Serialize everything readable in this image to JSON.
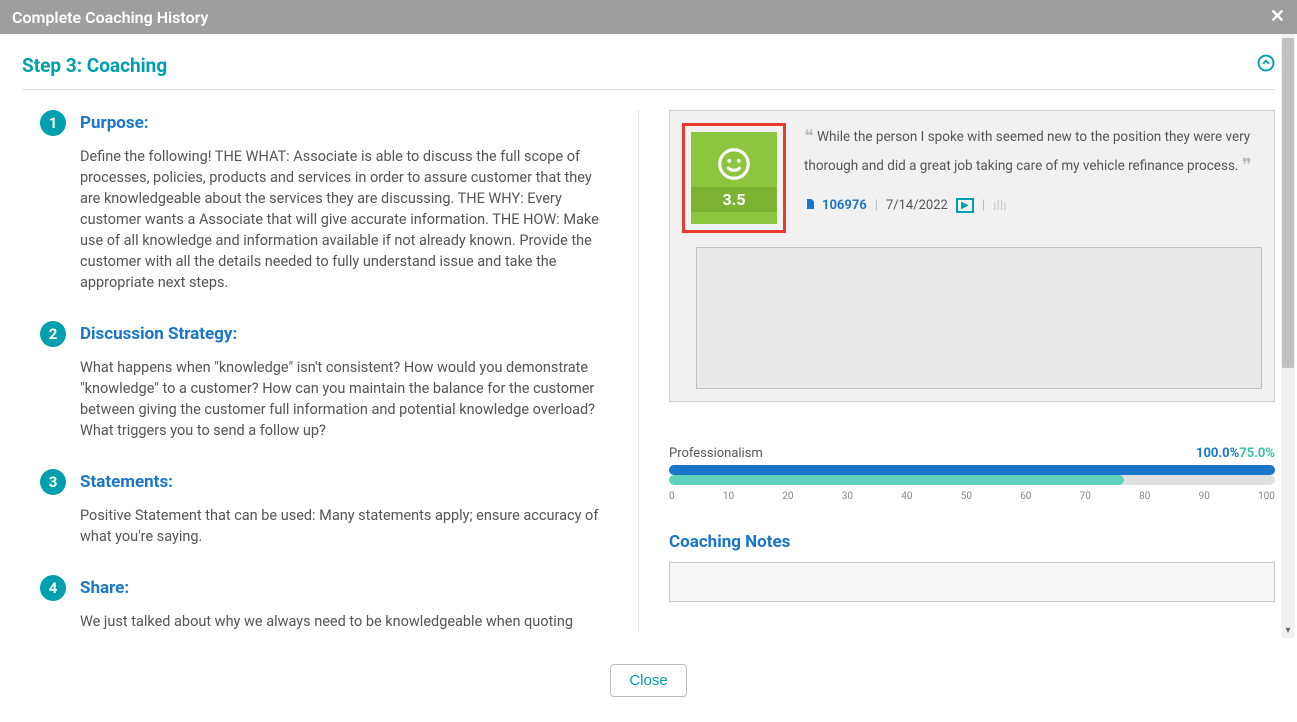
{
  "header": {
    "title": "Complete Coaching History"
  },
  "step": {
    "title": "Step 3: Coaching"
  },
  "sections": [
    {
      "num": "1",
      "title": "Purpose:",
      "body": "Define the following! THE WHAT: Associate is able to discuss the full scope of processes, policies, products and services in order to assure customer that they are knowledgeable about the services they are discussing. THE WHY: Every customer wants a Associate that will give accurate information. THE HOW: Make use of all knowledge and information available if not already known. Provide the customer with all the details needed to fully understand issue and take the appropriate next steps."
    },
    {
      "num": "2",
      "title": "Discussion Strategy:",
      "body": "What happens when \"knowledge\" isn't consistent? How would you demonstrate \"knowledge\" to a customer? How can you maintain the balance for the customer between giving the customer full information and potential knowledge overload? What triggers you to send a follow up?"
    },
    {
      "num": "3",
      "title": "Statements:",
      "body": "Positive Statement that can be used: Many statements apply; ensure accuracy of what you're saying."
    },
    {
      "num": "4",
      "title": "Share:",
      "body": "We just talked about why we always need to be knowledgeable when quoting"
    }
  ],
  "record": {
    "score": "3.5",
    "quote": "While the person I spoke with seemed new to the position they were very thorough and did a great job taking care of my vehicle refinance process.",
    "id": "106976",
    "date": "7/14/2022"
  },
  "metric": {
    "label": "Professionalism",
    "value1": "100.0%",
    "value2": "75.0%",
    "ticks": [
      "0",
      "10",
      "20",
      "30",
      "40",
      "50",
      "60",
      "70",
      "80",
      "90",
      "100"
    ]
  },
  "notes": {
    "title": "Coaching Notes"
  },
  "footer": {
    "close": "Close"
  },
  "chart_data": {
    "type": "bar",
    "title": "Professionalism",
    "series": [
      {
        "name": "value1",
        "values": [
          100.0
        ]
      },
      {
        "name": "value2",
        "values": [
          75.0
        ]
      }
    ],
    "categories": [
      "Professionalism"
    ],
    "xlabel": "",
    "ylabel": "",
    "ylim": [
      0,
      100
    ]
  }
}
